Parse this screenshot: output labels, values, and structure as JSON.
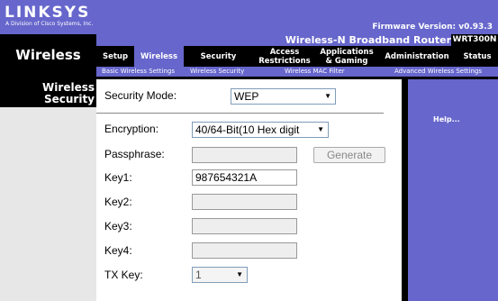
{
  "brand": {
    "name": "LINKSYS",
    "tagline": "A Division of Cisco Systems, Inc."
  },
  "firmware": "Firmware Version: v0.93.3",
  "product": "Wireless-N Broadband Router",
  "model": "WRT300N",
  "section_title": "Wireless",
  "nav": {
    "tabs": [
      {
        "label": "Setup"
      },
      {
        "label": "Wireless"
      },
      {
        "label": "Security"
      },
      {
        "label": "Access Restrictions"
      },
      {
        "label": "Applications & Gaming"
      },
      {
        "label": "Administration"
      },
      {
        "label": "Status"
      }
    ],
    "active_tab": "Wireless",
    "subtabs": [
      {
        "label": "Basic Wireless Settings"
      },
      {
        "label": "Wireless Security"
      },
      {
        "label": "Wireless MAC Filter"
      },
      {
        "label": "Advanced Wireless Settings"
      }
    ],
    "active_subtab": "Wireless Security"
  },
  "left_heading": "Wireless Security",
  "form": {
    "security_mode": {
      "label": "Security Mode:",
      "value": "WEP"
    },
    "encryption": {
      "label": "Encryption:",
      "value": "40/64-Bit(10 Hex digit"
    },
    "passphrase": {
      "label": "Passphrase:",
      "value": ""
    },
    "generate_label": "Generate",
    "key1": {
      "label": "Key1:",
      "value": "987654321A"
    },
    "key2": {
      "label": "Key2:",
      "value": ""
    },
    "key3": {
      "label": "Key3:",
      "value": ""
    },
    "key4": {
      "label": "Key4:",
      "value": ""
    },
    "tx_key": {
      "label": "TX Key:",
      "value": "1"
    }
  },
  "help_label": "Help...",
  "colors": {
    "accent": "#6666cc",
    "bar": "#000000",
    "panel": "#e7e7e7"
  }
}
